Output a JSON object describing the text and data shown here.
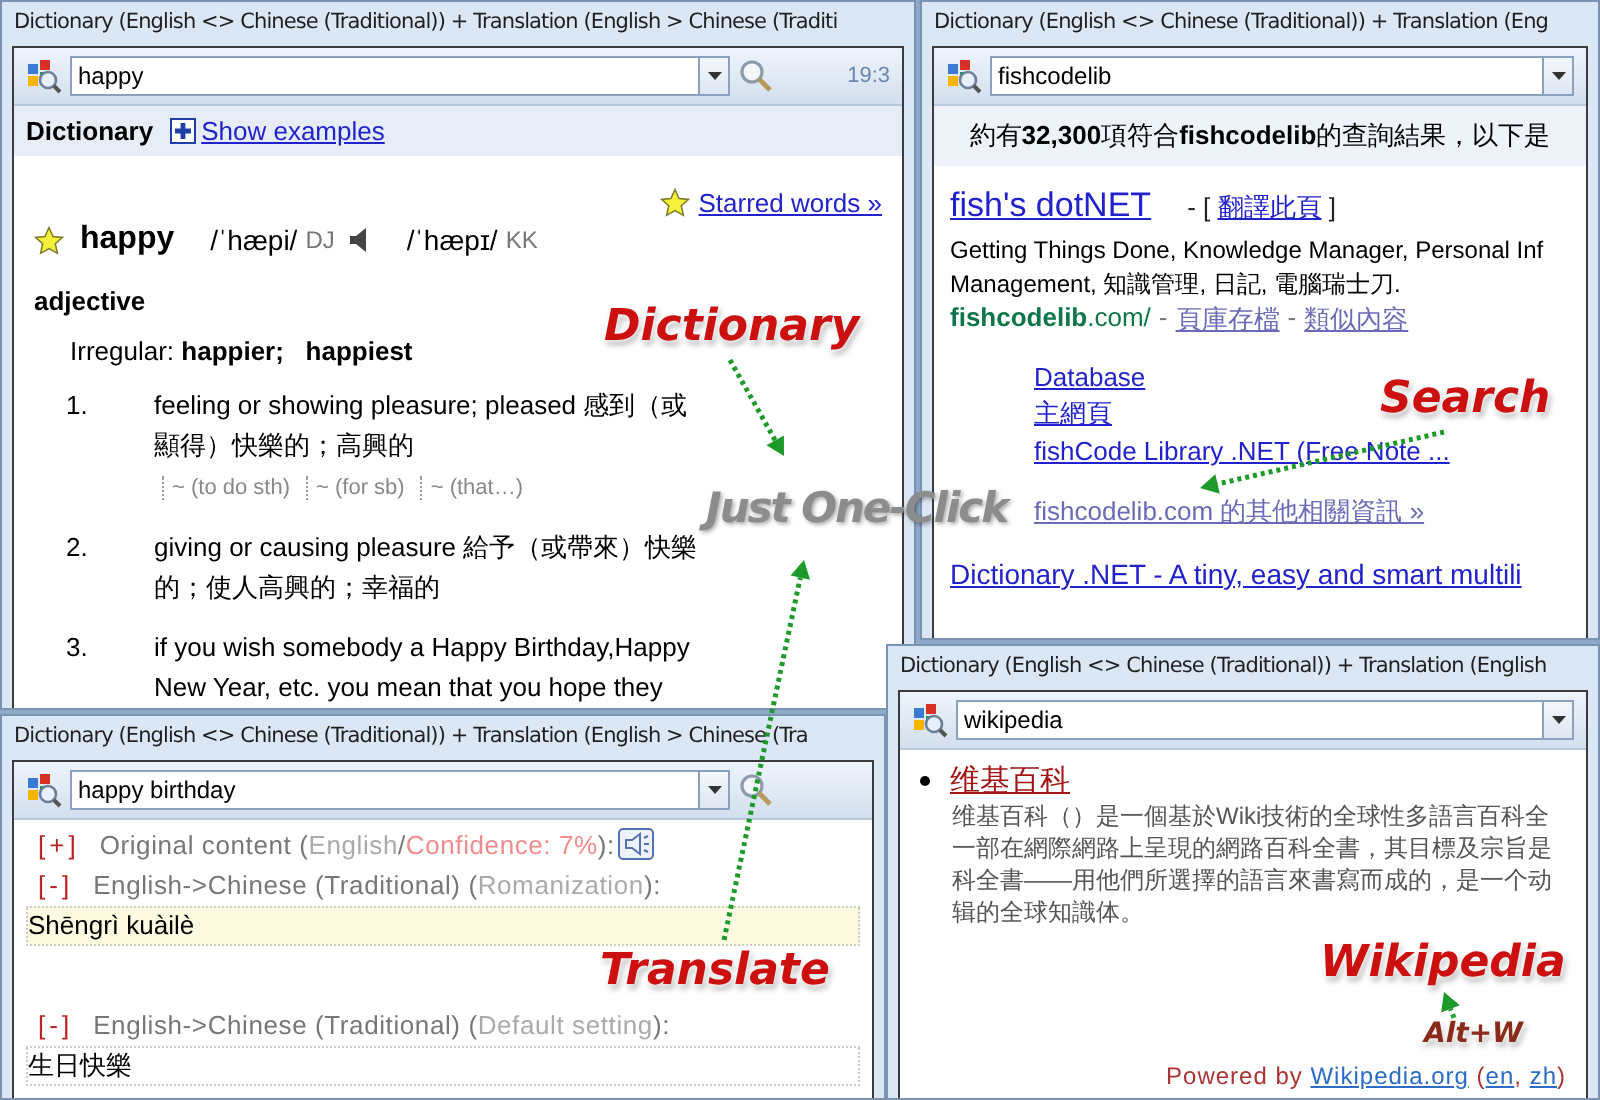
{
  "dictionary_window": {
    "title": "Dictionary (English <> Chinese (Traditional)) + Translation (English > Chinese (Traditi",
    "search": {
      "value": "happy"
    },
    "clock": "19:3",
    "header": {
      "title": "Dictionary",
      "link": "Show examples"
    },
    "starred_link": "Starred words »",
    "entry": {
      "word": "happy",
      "pron_1": "/ˈhæpi/",
      "pron_1_label": "DJ",
      "pron_2": "/ˈhæpɪ/",
      "pron_2_label": "KK",
      "pos": "adjective",
      "irregular_label": "Irregular:",
      "forms": [
        "happier;",
        "happiest"
      ]
    },
    "definitions": [
      {
        "number": "1.",
        "text": "feeling or showing pleasure; pleased 感到（或顯得）快樂的；高興的",
        "usages": [
          "~ (to do sth)",
          "~ (for sb)",
          "~ (that…)"
        ]
      },
      {
        "number": "2.",
        "text": "giving or causing pleasure 給予（或帶來）快樂的；使人高興的；幸福的"
      },
      {
        "number": "3.",
        "text": "if you wish somebody a Happy Birthday,Happy New Year, etc. you mean that you hope they"
      }
    ]
  },
  "search_window": {
    "title": "Dictionary (English <> Chinese (Traditional)) + Translation (Eng",
    "search": {
      "value": "fishcodelib"
    },
    "summary": "約有**32,300**項符合**fishcodelib**的查詢結果，以下是",
    "results": [
      {
        "title": "fish's dotNET",
        "translate_open": "- [",
        "translate": "翻譯此頁",
        "translate_close": "]",
        "snippet": [
          "Getting Things Done, Knowledge Manager, Personal Inf",
          "Management, 知識管理, 日記, 電腦瑞士刀."
        ],
        "url": "**fishcodelib**.com/",
        "separator": "-",
        "cache": "頁庫存檔",
        "similar": "類似內容",
        "sitelinks": [
          "Database",
          "主網頁",
          "fishCode Library .NET (Free Note ...",
          "fishcodelib.com 的其他相關資訊 »"
        ]
      },
      {
        "title": "Dictionary .NET - A tiny, easy and smart multili"
      }
    ]
  },
  "translate_window": {
    "title": "Dictionary (English <> Chinese (Traditional)) + Translation (English > Chinese (Tra",
    "search": {
      "value": "happy birthday"
    },
    "sections": [
      {
        "toggle": "[+]",
        "heading": [
          {
            "text": "Original content (",
            "kind": "label"
          },
          {
            "text": "English",
            "kind": "muted"
          },
          {
            "text": "/",
            "kind": "label"
          },
          {
            "text": "Confidence: 7%",
            "kind": "alert"
          },
          {
            "text": "):",
            "kind": "label"
          }
        ],
        "speaker": true
      },
      {
        "toggle": "[-]",
        "heading": [
          {
            "text": "English->Chinese (Traditional) (",
            "kind": "label"
          },
          {
            "text": "Romanization",
            "kind": "muted"
          },
          {
            "text": "):",
            "kind": "label"
          }
        ],
        "speaker": false,
        "result": "Shēngrì kuàilè",
        "highlighted": true
      },
      {
        "toggle": "[-]",
        "heading": [
          {
            "text": "English->Chinese (Traditional) (",
            "kind": "label"
          },
          {
            "text": "Default setting",
            "kind": "muted"
          },
          {
            "text": "):",
            "kind": "label"
          }
        ],
        "speaker": false,
        "result": "生日快樂",
        "highlighted": false
      }
    ]
  },
  "wiki_window": {
    "title": "Dictionary (English <> Chinese (Traditional)) + Translation (English",
    "search": {
      "value": "wikipedia"
    },
    "article": {
      "title": "维基百科",
      "lines": [
        "维基百科（）是一個基於Wiki技術的全球性多語言百科全",
        "一部在網際網路上呈現的網路百科全書，其目標及宗旨是",
        "科全書——用他們所選擇的語言來書寫而成的，是一个动",
        "辑的全球知識体。"
      ]
    },
    "footer": [
      {
        "text": "Powered by ",
        "kind": "plain"
      },
      {
        "text": "Wikipedia.org",
        "kind": "link"
      },
      {
        "text": " (",
        "kind": "plain"
      },
      {
        "text": "en",
        "kind": "link"
      },
      {
        "text": ", ",
        "kind": "plain"
      },
      {
        "text": "zh",
        "kind": "link"
      },
      {
        "text": ")",
        "kind": "plain"
      }
    ]
  },
  "banner": "Just One-Click",
  "callouts": [
    {
      "text": "Dictionary",
      "kind": "label"
    },
    {
      "text": "Search",
      "kind": "label"
    },
    {
      "text": "Translate",
      "kind": "label"
    },
    {
      "text": "Wikipedia",
      "kind": "label"
    },
    {
      "text": "Alt+W",
      "kind": "hotkey"
    }
  ]
}
